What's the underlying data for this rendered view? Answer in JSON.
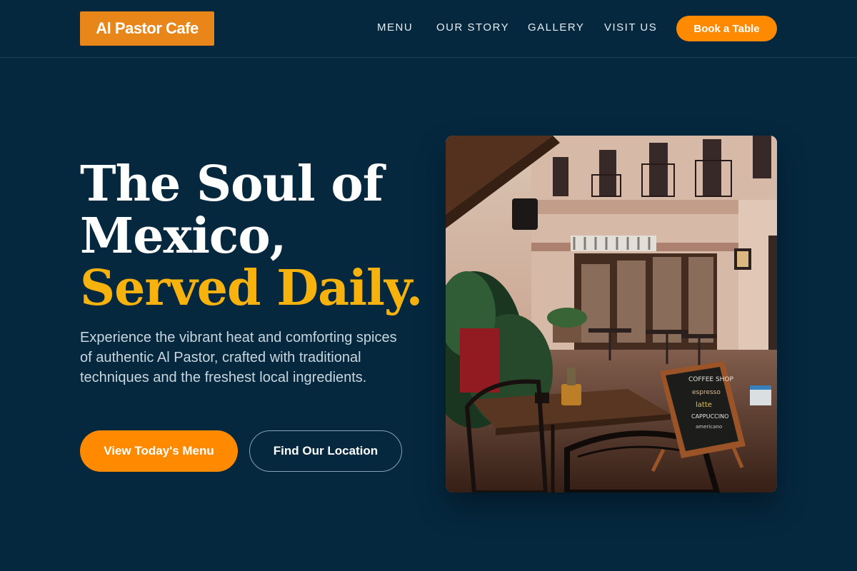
{
  "header": {
    "logo": "Al Pastor Cafe",
    "nav": [
      "MENU",
      "OUR STORY",
      "GALLERY",
      "VISIT US"
    ],
    "cta": "Book a Table"
  },
  "hero": {
    "title_line1": "The Soul of",
    "title_line2": "Mexico,",
    "title_accent": "Served Daily.",
    "subtitle": "Experience the vibrant heat and comforting spices of authentic Al Pastor, crafted with traditional techniques and the freshest local ingredients.",
    "primary_button": "View Today's Menu",
    "secondary_button": "Find Our Location"
  },
  "photo": {
    "alt": "Cafe street terrace",
    "chalkboard": [
      "COFFEE SHOP",
      "espresso",
      "latte",
      "CAPPUCCINO",
      "americano"
    ]
  },
  "colors": {
    "background": "#05283f",
    "accent_orange": "#ff8a00",
    "logo_orange": "#e8861a",
    "accent_yellow": "#f7b20e"
  }
}
